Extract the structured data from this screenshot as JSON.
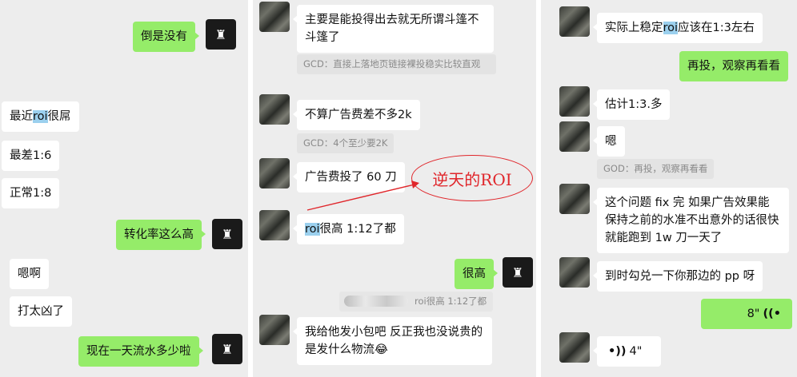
{
  "left": {
    "messages": [
      {
        "text": "倒是没有"
      },
      {
        "pre": "最近",
        "hl": "roi",
        "post": "很屌"
      },
      {
        "text": "最差1:6"
      },
      {
        "text": "正常1:8"
      },
      {
        "text": "转化率这么高"
      },
      {
        "text": "嗯啊"
      },
      {
        "text": "打太凶了"
      },
      {
        "text": "现在一天流水多少啦"
      }
    ]
  },
  "middle": {
    "messages": [
      {
        "text": "主要是能投得出去就无所谓斗篷不斗篷了"
      },
      {
        "quote": "GCD：直接上落地页链接裸投稳实比较直观"
      },
      {
        "text": "不算广告费差不多2k"
      },
      {
        "quote": "GCD：4个至少要2K"
      },
      {
        "text": "广告费投了 60 刀"
      },
      {
        "hl": "roi",
        "post": "很高 1:12了都"
      },
      {
        "text": "很高"
      },
      {
        "quote": "roi很高 1:12了都"
      },
      {
        "text": "我给他发小包吧 反正我也没说贵的是发什么物流😂"
      }
    ],
    "annotation": "逆天的ROI"
  },
  "right": {
    "messages": [
      {
        "pre": "实际上稳定",
        "hl": "roi",
        "post": "应该在1:3左右"
      },
      {
        "text": "再投，观察再看看"
      },
      {
        "text": "估计1:3.多"
      },
      {
        "text": "嗯"
      },
      {
        "quote": "GOD：再投，观察再看看"
      },
      {
        "text": "这个问题 fix 完 如果广告效果能保持之前的水准不出意外的话很快就能跑到 1w 刀一天了"
      },
      {
        "text": "到时勾兑一下你那边的 pp 呀"
      },
      {
        "voice": "8\""
      },
      {
        "voice": "4\""
      }
    ]
  },
  "colors": {
    "outgoing": "#95ec69",
    "incoming": "#ffffff",
    "highlight": "#9bd0ee",
    "annotation": "#e0262b",
    "background": "#ededed"
  }
}
